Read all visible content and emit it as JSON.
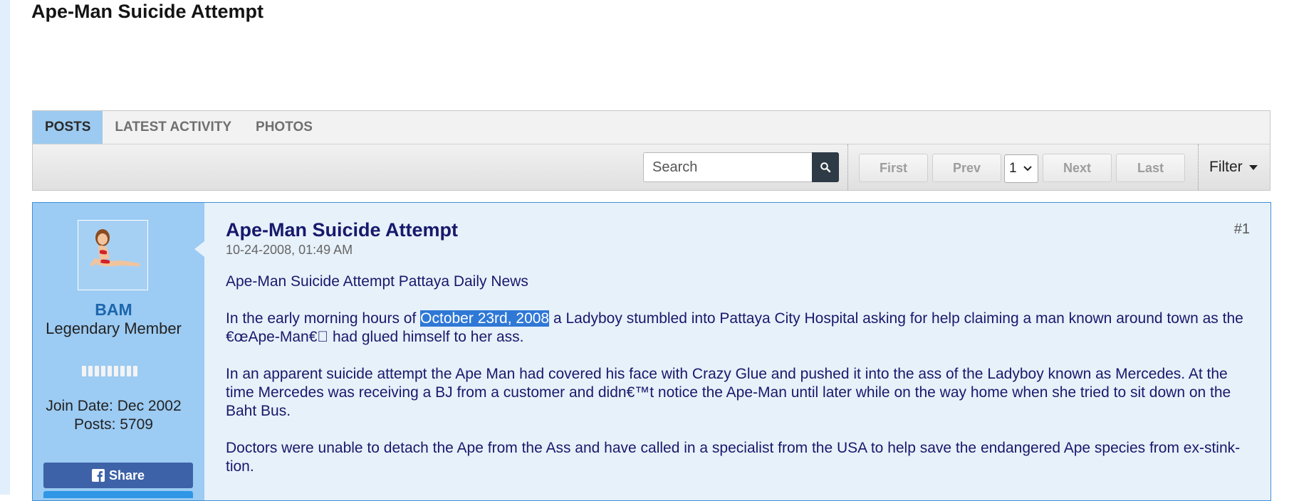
{
  "page": {
    "title": "Ape-Man Suicide Attempt"
  },
  "tabs": [
    {
      "label": "POSTS",
      "active": true
    },
    {
      "label": "LATEST ACTIVITY",
      "active": false
    },
    {
      "label": "PHOTOS",
      "active": false
    }
  ],
  "toolbar": {
    "search_placeholder": "Search",
    "first_label": "First",
    "prev_label": "Prev",
    "page_value": "1",
    "next_label": "Next",
    "last_label": "Last",
    "filter_label": "Filter"
  },
  "post": {
    "title": "Ape-Man Suicide Attempt",
    "date": "10-24-2008, 01:49 AM",
    "number": "#1",
    "author": {
      "name": "BAM",
      "title": "Legendary Member",
      "join_date": "Join Date: Dec 2002",
      "posts": "Posts: 5709",
      "share_label": "Share"
    },
    "body": {
      "p1": "Ape-Man Suicide Attempt Pattaya Daily News",
      "p2_before": "In the early morning hours of ",
      "p2_highlight": "October 23rd, 2008",
      "p2_after": " a Ladyboy stumbled into Pattaya City Hospital asking for help claiming a man known around town as the €œApe-Man€\u0000 had glued himself to her ass.",
      "p3": "In an apparent suicide attempt the Ape Man had covered his face with Crazy Glue and pushed it into the ass of the Ladyboy known as Mercedes. At the time Mercedes was receiving a BJ from a customer and didn€™t notice the Ape-Man until later while on the way home when she tried to sit down on the Baht Bus.",
      "p4": "Doctors were unable to detach the Ape from the Ass and have called in a specialist from the USA to help save the endangered Ape species from ex-stink-tion."
    }
  },
  "colors": {
    "accent": "#9ccbf3",
    "post_bg": "#e7f1fa",
    "link": "#1c66ac",
    "highlight": "#2f78d6",
    "share": "#3e62a7"
  }
}
